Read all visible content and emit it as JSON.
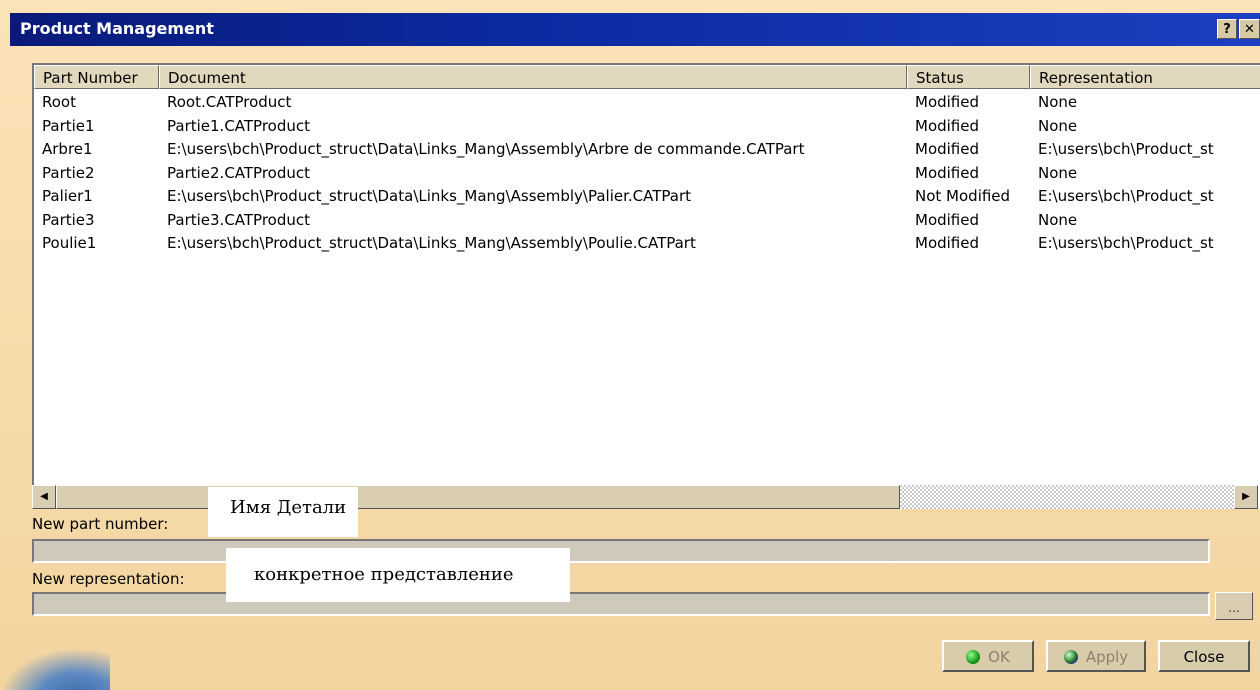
{
  "window": {
    "title": "Product Management",
    "help_glyph": "?",
    "close_glyph": "✕"
  },
  "table": {
    "columns": [
      "Part Number",
      "Document",
      "Status",
      "Representation"
    ],
    "rows": [
      {
        "part": "Root",
        "doc": "Root.CATProduct",
        "status": "Modified",
        "rep": "None"
      },
      {
        "part": "Partie1",
        "doc": "Partie1.CATProduct",
        "status": "Modified",
        "rep": "None"
      },
      {
        "part": "Arbre1",
        "doc": "E:\\users\\bch\\Product_struct\\Data\\Links_Mang\\Assembly\\Arbre de commande.CATPart",
        "status": "Modified",
        "rep": "E:\\users\\bch\\Product_st"
      },
      {
        "part": "Partie2",
        "doc": "Partie2.CATProduct",
        "status": "Modified",
        "rep": "None"
      },
      {
        "part": "Palier1",
        "doc": "E:\\users\\bch\\Product_struct\\Data\\Links_Mang\\Assembly\\Palier.CATPart",
        "status": "Not Modified",
        "rep": "E:\\users\\bch\\Product_st"
      },
      {
        "part": "Partie3",
        "doc": "Partie3.CATProduct",
        "status": "Modified",
        "rep": "None"
      },
      {
        "part": "Poulie1",
        "doc": "E:\\users\\bch\\Product_struct\\Data\\Links_Mang\\Assembly\\Poulie.CATPart",
        "status": "Modified",
        "rep": "E:\\users\\bch\\Product_st"
      }
    ]
  },
  "scrollbar": {
    "left_glyph": "◀",
    "right_glyph": "▶"
  },
  "form": {
    "new_part_label": "New part number:",
    "new_part_value": "",
    "new_rep_label": "New representation:",
    "new_rep_value": "",
    "browse_label": "..."
  },
  "annotations": {
    "part_name": "Имя Детали",
    "specific_rep": "конкретное представление"
  },
  "buttons": {
    "ok": "OK",
    "apply": "Apply",
    "close": "Close"
  },
  "colors": {
    "titlebar": "#0b2aa0",
    "dialog_bg": "#f3d9a8"
  }
}
